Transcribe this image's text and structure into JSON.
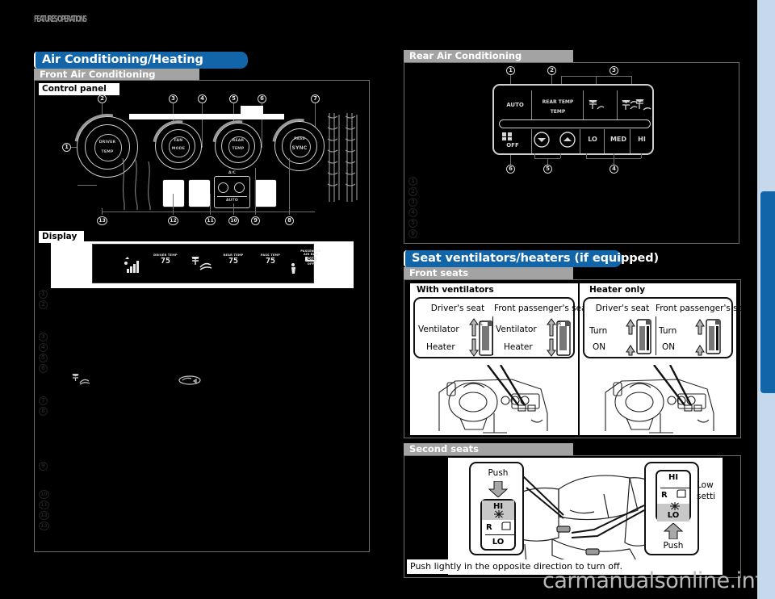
{
  "header": {
    "running_title": "FEATURES/OPERATIONS"
  },
  "watermark": {
    "text": "carmanualsonline.info"
  },
  "sections": {
    "air_conditioning": {
      "banner": "Air Conditioning/Heating",
      "subbanner": "Front Air Conditioning",
      "control_panel_caption": "Control panel",
      "display_caption": "Display",
      "callouts_top": [
        "2",
        "3",
        "4",
        "5",
        "6",
        "7"
      ],
      "callouts_bottom": [
        "13",
        "12",
        "11",
        "10",
        "9",
        "8"
      ],
      "callout_left": "1",
      "dial_labels": [
        "AUTO",
        "MODE",
        "A/C",
        "TEMP",
        "FAN",
        "SYNC",
        "DRIVER",
        "PASS",
        "REAR"
      ],
      "list_numbers": [
        "1",
        "2",
        "3",
        "4",
        "5",
        "6",
        "7",
        "8",
        "9",
        "10",
        "11",
        "12",
        "13"
      ]
    },
    "display_panel": {
      "segments": [
        {
          "label": "",
          "value": "",
          "icon": "fan-bars-icon"
        },
        {
          "label": "DRIVER TEMP",
          "value": "75",
          "icon": ""
        },
        {
          "label": "",
          "value": "",
          "icon": "airflow-mode-icon"
        },
        {
          "label": "REAR TEMP",
          "value": "75",
          "icon": ""
        },
        {
          "label": "PASS TEMP",
          "value": "75",
          "icon": ""
        },
        {
          "label": "",
          "value": "",
          "icon": "defogger-icon"
        }
      ],
      "airbag": {
        "line1": "PASSENGER",
        "line2": "AIR BAG",
        "on": "ON",
        "off": "OFF"
      }
    },
    "rear_air_conditioning": {
      "subbanner": "Rear Air Conditioning",
      "callouts_top": [
        "1",
        "2",
        "3"
      ],
      "callouts_bottom": [
        "6",
        "5",
        "4"
      ],
      "buttons_row1": [
        "AUTO",
        "REAR TEMP",
        "mode-face-icon",
        "mode-bilevel-icon",
        "mode-foot-icon"
      ],
      "buttons_row2": [
        "OFF",
        "temp-down-icon",
        "temp-up-icon",
        "LO",
        "MED",
        "HI"
      ],
      "temp_label": "TEMP",
      "list_numbers": [
        "1",
        "2",
        "3",
        "4",
        "5",
        "6"
      ]
    },
    "seat_ventilators": {
      "banner": "Seat ventilators/heaters (if equipped)",
      "subbanner_front": "Front seats",
      "subbanner_second": "Second seats",
      "front": {
        "group_left_caption": "With ventilators",
        "group_right_caption": "Heater only",
        "left": {
          "seat1_title": "Driver's seat",
          "seat2_title": "Front passenger's seat",
          "up_label": "Ventilator",
          "down_label": "Heater",
          "switch_left_mark": "L",
          "switch_right_mark": "R"
        },
        "right": {
          "seat1_title": "Driver's seat",
          "seat2_title": "Front passenger's seat",
          "up_label": "Turn",
          "down_label": "ON"
        }
      },
      "second": {
        "left_switch": {
          "push": "Push",
          "rows": [
            "HI",
            "R",
            "LO"
          ]
        },
        "right_switch": {
          "push": "Push",
          "rows": [
            "HI",
            "R",
            "LO"
          ]
        },
        "side_note_line1": "Low",
        "side_note_line2": "setti",
        "footer_note": "Push lightly in the opposite direction to turn off."
      }
    }
  },
  "sidebar": {
    "tab_label": ""
  },
  "colors": {
    "banner_blue": "#1265a8",
    "subbanner_gray": "#a3a3a3",
    "page_black": "#000000",
    "sidebar_blue": "#c6d9ec",
    "watermark_gray": "#b9b9b9"
  }
}
